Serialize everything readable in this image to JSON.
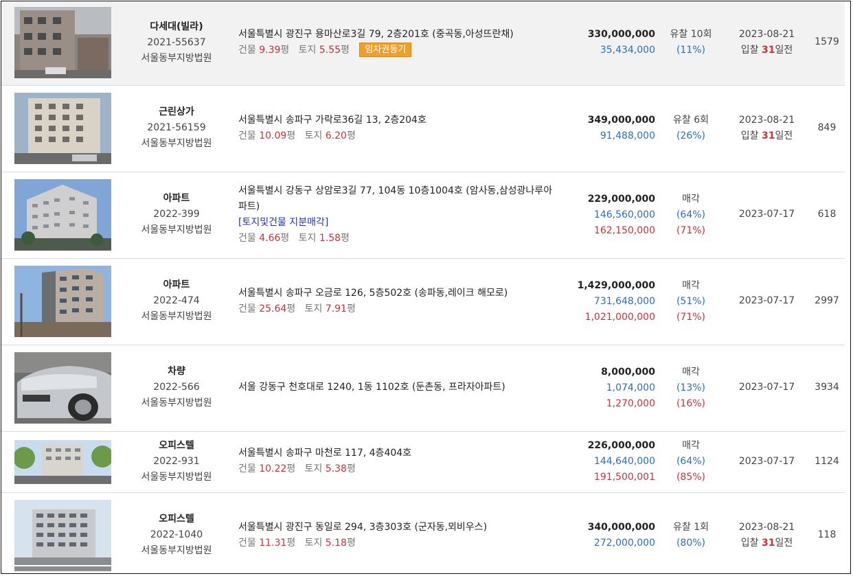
{
  "rows": [
    {
      "type": "다세대(빌라)",
      "case_no": "2021-55637",
      "court": "서울동부지방법원",
      "address": "서울특별시 광진구 용마산로3길 79, 2층201호 (중곡동,아성뜨란채)",
      "tag": "",
      "building_label": "건물",
      "building_area": "9.39",
      "land_label": "토지",
      "land_area": "5.55",
      "unit": "평",
      "badge": "임차권등기",
      "appraisal": "330,000,000",
      "min_bid": "35,434,000",
      "sale_price": "",
      "status": "유찰 10회",
      "min_ratio": "(11%)",
      "sale_ratio": "",
      "date": "2023-08-21",
      "bid_prefix": "입찰",
      "bid_days": "31",
      "bid_suffix": "일전",
      "views": "1579"
    },
    {
      "type": "근린상가",
      "case_no": "2021-56159",
      "court": "서울동부지방법원",
      "address": "서울특별시 송파구 가락로36길 13, 2층204호",
      "tag": "",
      "building_label": "건물",
      "building_area": "10.09",
      "land_label": "토지",
      "land_area": "6.20",
      "unit": "평",
      "badge": "",
      "appraisal": "349,000,000",
      "min_bid": "91,488,000",
      "sale_price": "",
      "status": "유찰 6회",
      "min_ratio": "(26%)",
      "sale_ratio": "",
      "date": "2023-08-21",
      "bid_prefix": "입찰",
      "bid_days": "31",
      "bid_suffix": "일전",
      "views": "849"
    },
    {
      "type": "아파트",
      "case_no": "2022-399",
      "court": "서울동부지방법원",
      "address": "서울특별시 강동구 상암로3길 77, 104동 10층1004호 (암사동,삼성광나루아파트)",
      "tag": "[토지및건물 지분매각]",
      "building_label": "건물",
      "building_area": "4.66",
      "land_label": "토지",
      "land_area": "1.58",
      "unit": "평",
      "badge": "",
      "appraisal": "229,000,000",
      "min_bid": "146,560,000",
      "sale_price": "162,150,000",
      "status": "매각",
      "min_ratio": "(64%)",
      "sale_ratio": "(71%)",
      "date": "2023-07-17",
      "bid_prefix": "",
      "bid_days": "",
      "bid_suffix": "",
      "views": "618"
    },
    {
      "type": "아파트",
      "case_no": "2022-474",
      "court": "서울동부지방법원",
      "address": "서울특별시 송파구 오금로 126, 5층502호 (송파동,레이크 해모로)",
      "tag": "",
      "building_label": "건물",
      "building_area": "25.64",
      "land_label": "토지",
      "land_area": "7.91",
      "unit": "평",
      "badge": "",
      "appraisal": "1,429,000,000",
      "min_bid": "731,648,000",
      "sale_price": "1,021,000,000",
      "status": "매각",
      "min_ratio": "(51%)",
      "sale_ratio": "(71%)",
      "date": "2023-07-17",
      "bid_prefix": "",
      "bid_days": "",
      "bid_suffix": "",
      "views": "2997"
    },
    {
      "type": "차량",
      "case_no": "2022-566",
      "court": "서울동부지방법원",
      "address": "서울 강동구 천호대로 1240, 1동 1102호 (둔촌동, 프라자아파트)",
      "tag": "",
      "building_label": "",
      "building_area": "",
      "land_label": "",
      "land_area": "",
      "unit": "",
      "badge": "",
      "appraisal": "8,000,000",
      "min_bid": "1,074,000",
      "sale_price": "1,270,000",
      "status": "매각",
      "min_ratio": "(13%)",
      "sale_ratio": "(16%)",
      "date": "2023-07-17",
      "bid_prefix": "",
      "bid_days": "",
      "bid_suffix": "",
      "views": "3934"
    },
    {
      "type": "오피스텔",
      "case_no": "2022-931",
      "court": "서울동부지방법원",
      "address": "서울특별시 송파구 마천로 117, 4층404호",
      "tag": "",
      "building_label": "건물",
      "building_area": "10.22",
      "land_label": "토지",
      "land_area": "5.38",
      "unit": "평",
      "badge": "",
      "appraisal": "226,000,000",
      "min_bid": "144,640,000",
      "sale_price": "191,500,001",
      "status": "매각",
      "min_ratio": "(64%)",
      "sale_ratio": "(85%)",
      "date": "2023-07-17",
      "bid_prefix": "",
      "bid_days": "",
      "bid_suffix": "",
      "views": "1124"
    },
    {
      "type": "오피스텔",
      "case_no": "2022-1040",
      "court": "서울동부지방법원",
      "address": "서울특별시 광진구 동일로 294, 3층303호 (군자동,뫼비우스)",
      "tag": "",
      "building_label": "건물",
      "building_area": "11.31",
      "land_label": "토지",
      "land_area": "5.18",
      "unit": "평",
      "badge": "",
      "appraisal": "340,000,000",
      "min_bid": "272,000,000",
      "sale_price": "",
      "status": "유찰 1회",
      "min_ratio": "(80%)",
      "sale_ratio": "",
      "date": "2023-08-21",
      "bid_prefix": "입찰",
      "bid_days": "31",
      "bid_suffix": "일전",
      "views": "118"
    }
  ]
}
